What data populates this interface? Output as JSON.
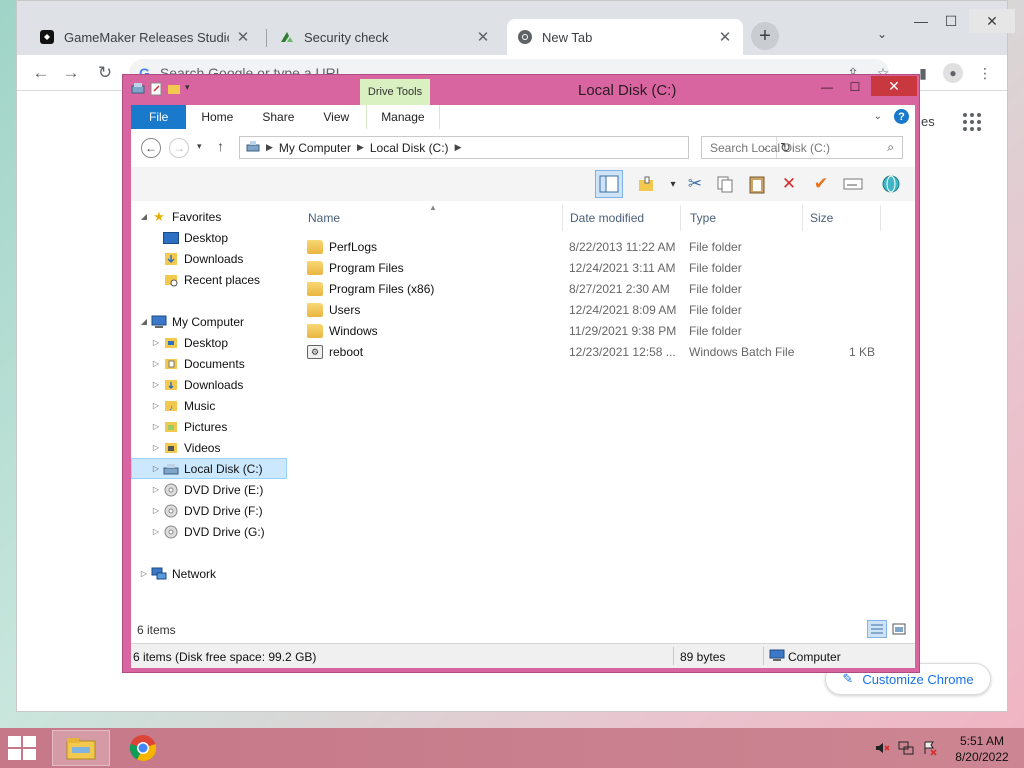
{
  "browser": {
    "tabs": [
      {
        "title": "GameMaker Releases Studio Vers",
        "close": "✕",
        "favicon": "gamemaker-icon"
      },
      {
        "title": "Security check",
        "close": "✕",
        "favicon": "security-check-icon"
      },
      {
        "title": "New Tab",
        "close": "✕",
        "favicon": "chrome-icon"
      }
    ],
    "new_tab": "+",
    "tab_search": "⌄",
    "window_controls": {
      "minimize": "—",
      "maximize": "☐",
      "close": "✕"
    },
    "omnibox_placeholder": "Search Google or type a URL",
    "omnibox_g": "G",
    "ntp_link_fragment": "es",
    "customize_label": "Customize Chrome"
  },
  "explorer": {
    "title": "Local Disk (C:)",
    "contextual_tab": "Drive Tools",
    "ribbon_tabs": [
      "File",
      "Home",
      "Share",
      "View",
      "Manage"
    ],
    "address_path": [
      "My Computer",
      "Local Disk (C:)"
    ],
    "search_placeholder": "Search Local Disk (C:)",
    "controls": {
      "minimize": "—",
      "maximize": "☐",
      "close": "✕"
    },
    "help": "?",
    "nav": {
      "favorites_label": "Favorites",
      "favorites": [
        "Desktop",
        "Downloads",
        "Recent places"
      ],
      "computer_label": "My Computer",
      "computer": [
        "Desktop",
        "Documents",
        "Downloads",
        "Music",
        "Pictures",
        "Videos",
        "Local Disk (C:)",
        "DVD Drive (E:)",
        "DVD Drive (F:)",
        "DVD Drive (G:)"
      ],
      "network_label": "Network",
      "selected": "Local Disk (C:)"
    },
    "columns": [
      "Name",
      "Date modified",
      "Type",
      "Size"
    ],
    "files": [
      {
        "name": "PerfLogs",
        "date": "8/22/2013 11:22 AM",
        "type": "File folder",
        "size": "",
        "kind": "folder"
      },
      {
        "name": "Program Files",
        "date": "12/24/2021 3:11 AM",
        "type": "File folder",
        "size": "",
        "kind": "folder"
      },
      {
        "name": "Program Files (x86)",
        "date": "8/27/2021 2:30 AM",
        "type": "File folder",
        "size": "",
        "kind": "folder"
      },
      {
        "name": "Users",
        "date": "12/24/2021 8:09 AM",
        "type": "File folder",
        "size": "",
        "kind": "folder"
      },
      {
        "name": "Windows",
        "date": "11/29/2021 9:38 PM",
        "type": "File folder",
        "size": "",
        "kind": "folder"
      },
      {
        "name": "reboot",
        "date": "12/23/2021 12:58 ...",
        "type": "Windows Batch File",
        "size": "1 KB",
        "kind": "batch"
      }
    ],
    "item_count": "6 items",
    "statusbar": {
      "left": "6 items (Disk free space: 99.2 GB)",
      "middle": "89 bytes",
      "right": "Computer"
    }
  },
  "taskbar": {
    "clock_time": "5:51 AM",
    "clock_date": "8/20/2022"
  },
  "colors": {
    "explorer_frame": "#d865a0",
    "file_tab": "#1979ca",
    "drive_tools": "#d9f0c0",
    "chrome_link": "#1a73e8"
  }
}
